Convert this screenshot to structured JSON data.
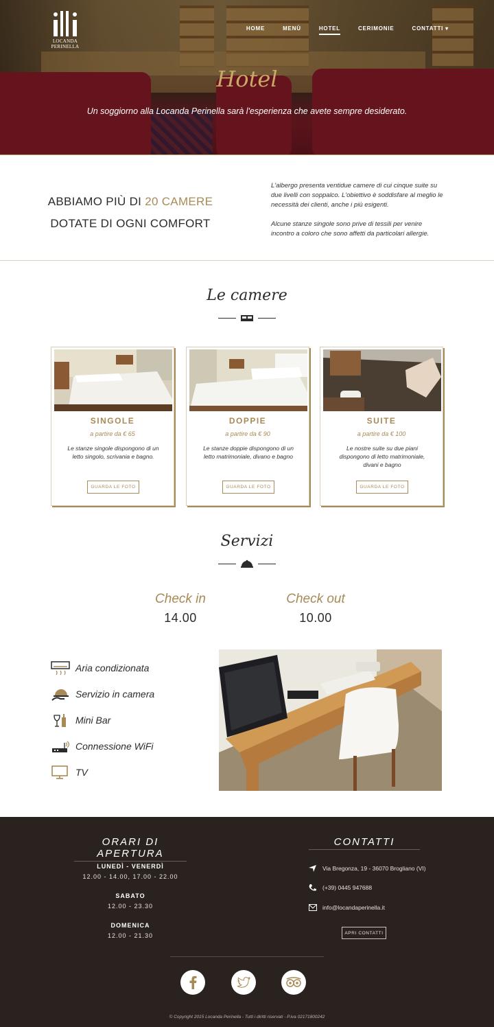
{
  "brand": {
    "logo_line1": "LOCANDA",
    "logo_line2": "PERINELLA"
  },
  "nav": {
    "items": [
      "HOME",
      "MENÙ",
      "HOTEL",
      "CERIMONIE",
      "CONTATTI ▾"
    ],
    "active": "HOTEL"
  },
  "hero": {
    "title": "Hotel",
    "subtitle": "Un soggiorno alla Locanda Perinella sarà l'esperienza che avete sempre desiderato."
  },
  "intro": {
    "headline_a": "ABBIAMO PIÙ DI",
    "headline_highlight": "20 CAMERE",
    "headline_b": "DOTATE DI OGNI COMFORT",
    "para1": "L'albergo presenta ventidue camere di cui cinque suite su due livelli con soppalco. L'obiettivo è soddisfare al meglio le necessità dei clienti, anche i più esigenti.",
    "para2": "Alcune stanze singole sono prive di tessili per venire incontro a coloro che sono affetti da particolari allergie."
  },
  "rooms": {
    "title": "Le camere",
    "cards": [
      {
        "name": "SINGOLE",
        "price": "a partire da € 65",
        "desc": "Le stanze singole dispongono di un letto singolo, scrivania e bagno.",
        "button": "GUARDA LE FOTO"
      },
      {
        "name": "DOPPIE",
        "price": "a partire da € 90",
        "desc": "Le stanze doppie dispongono di un letto matrimoniale, divano e bagno",
        "button": "GUARDA LE FOTO"
      },
      {
        "name": "SUITE",
        "price": "a partire da € 100",
        "desc": "Le nostre suite su due piani dispongono di letto matrimoniale, divani e bagno",
        "button": "GUARDA LE FOTO"
      }
    ]
  },
  "services": {
    "title": "Servizi",
    "checkin_label": "Check in",
    "checkin_time": "14.00",
    "checkout_label": "Check out",
    "checkout_time": "10.00",
    "items": [
      {
        "label": "Aria condizionata",
        "icon": "air-conditioner-icon"
      },
      {
        "label": "Servizio in camera",
        "icon": "room-service-icon"
      },
      {
        "label": "Mini Bar",
        "icon": "minibar-icon"
      },
      {
        "label": "Connessione WiFi",
        "icon": "wifi-router-icon"
      },
      {
        "label": "TV",
        "icon": "tv-icon"
      }
    ]
  },
  "footer": {
    "hours_title": "ORARI DI APERTURA",
    "hours": [
      {
        "day": "LUNEDÌ - VENERDÌ",
        "time": "12.00 - 14.00, 17.00 - 22.00"
      },
      {
        "day": "SABATO",
        "time": "12.00 - 23.30"
      },
      {
        "day": "DOMENICA",
        "time": "12.00 - 21.30"
      }
    ],
    "contacts_title": "CONTATTI",
    "address": "Via Bregonza, 19 - 36070 Brogliano (VI)",
    "phone": "(+39) 0445 947688",
    "email": "info@locandaperinella.it",
    "contacts_button": "APRI CONTATTI",
    "copyright": "© Copyright 2015 Locanda Perinella - Tutti i diritti riservati - P.iva 02171800242"
  },
  "colors": {
    "accent": "#a88a57",
    "footer_bg": "#2a221e",
    "hero_red": "#8c1c2a"
  }
}
